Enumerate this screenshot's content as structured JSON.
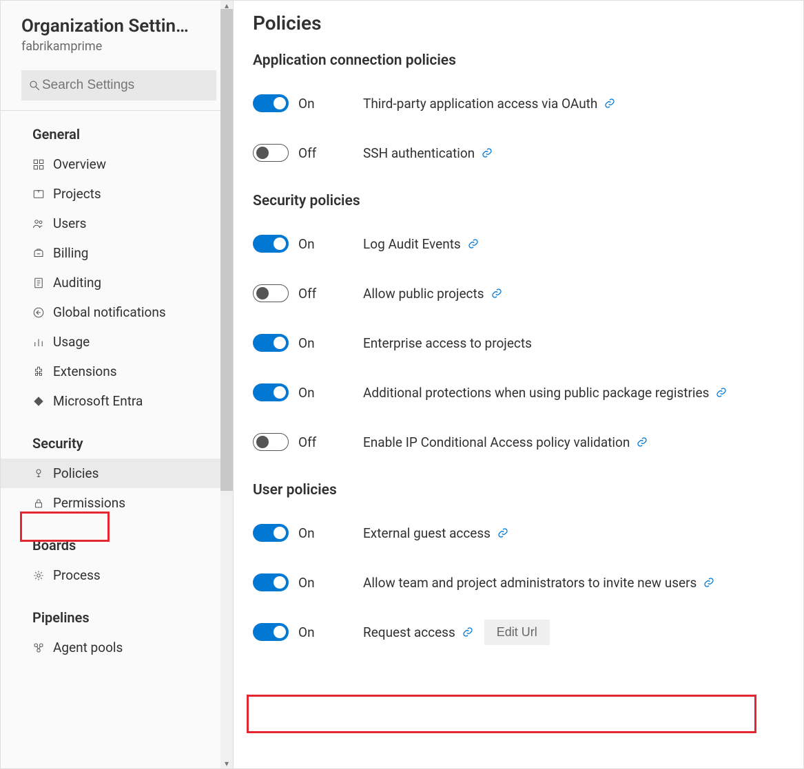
{
  "sidebar": {
    "title": "Organization Settin…",
    "subtitle": "fabrikamprime",
    "search_placeholder": "Search Settings",
    "sections": [
      {
        "heading": "General",
        "items": [
          {
            "icon": "overview-icon",
            "label": "Overview"
          },
          {
            "icon": "projects-icon",
            "label": "Projects"
          },
          {
            "icon": "users-icon",
            "label": "Users"
          },
          {
            "icon": "billing-icon",
            "label": "Billing"
          },
          {
            "icon": "auditing-icon",
            "label": "Auditing"
          },
          {
            "icon": "notifications-icon",
            "label": "Global notifications"
          },
          {
            "icon": "usage-icon",
            "label": "Usage"
          },
          {
            "icon": "extensions-icon",
            "label": "Extensions"
          },
          {
            "icon": "entra-icon",
            "label": "Microsoft Entra"
          }
        ]
      },
      {
        "heading": "Security",
        "items": [
          {
            "icon": "policies-icon",
            "label": "Policies",
            "selected": true
          },
          {
            "icon": "permissions-icon",
            "label": "Permissions"
          }
        ]
      },
      {
        "heading": "Boards",
        "items": [
          {
            "icon": "process-icon",
            "label": "Process"
          }
        ]
      },
      {
        "heading": "Pipelines",
        "items": [
          {
            "icon": "agentpools-icon",
            "label": "Agent pools"
          }
        ]
      }
    ]
  },
  "main": {
    "title": "Policies",
    "toggle_on_label": "On",
    "toggle_off_label": "Off",
    "edit_url_label": "Edit Url",
    "groups": [
      {
        "heading": "Application connection policies",
        "policies": [
          {
            "state": "on",
            "label": "Third-party application access via OAuth",
            "link": true
          },
          {
            "state": "off",
            "label": "SSH authentication",
            "link": true
          }
        ]
      },
      {
        "heading": "Security policies",
        "policies": [
          {
            "state": "on",
            "label": "Log Audit Events",
            "link": true
          },
          {
            "state": "off",
            "label": "Allow public projects",
            "link": true
          },
          {
            "state": "on",
            "label": "Enterprise access to projects",
            "link": false
          },
          {
            "state": "on",
            "label": "Additional protections when using public package registries",
            "link": true
          },
          {
            "state": "off",
            "label": "Enable IP Conditional Access policy validation",
            "link": true
          }
        ]
      },
      {
        "heading": "User policies",
        "policies": [
          {
            "state": "on",
            "label": "External guest access",
            "link": true
          },
          {
            "state": "on",
            "label": "Allow team and project administrators to invite new users",
            "link": true
          },
          {
            "state": "on",
            "label": "Request access",
            "link": true,
            "edit_url": true
          }
        ]
      }
    ]
  }
}
